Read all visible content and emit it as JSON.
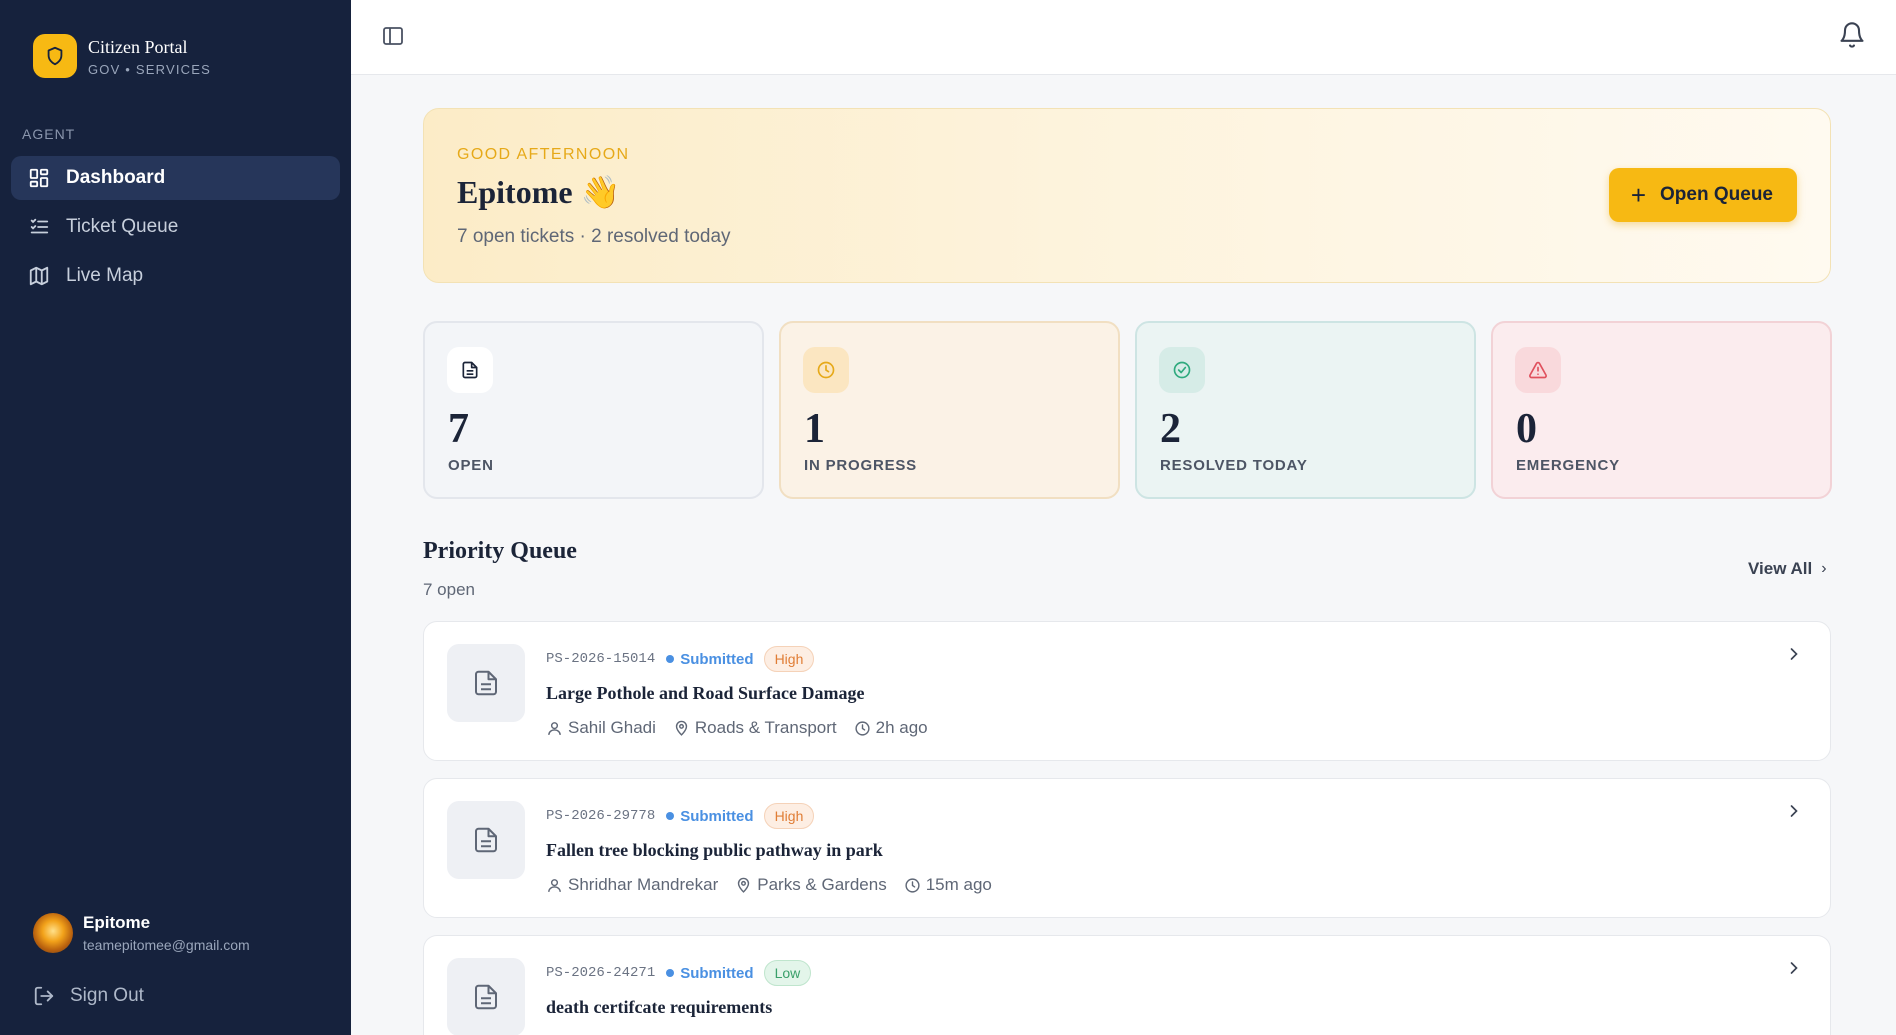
{
  "brand": {
    "title": "Citizen Portal",
    "subtitle": "GOV • SERVICES",
    "logo_icon": "shield-icon",
    "accent": "#f7b913"
  },
  "sidebar": {
    "section_label": "AGENT",
    "items": [
      {
        "label": "Dashboard",
        "icon": "dashboard-grid-icon",
        "active": true
      },
      {
        "label": "Ticket Queue",
        "icon": "list-icon",
        "active": false
      },
      {
        "label": "Live Map",
        "icon": "map-icon",
        "active": false
      }
    ],
    "user": {
      "name": "Epitome",
      "email": "teamepitomee@gmail.com"
    },
    "signout_label": "Sign Out"
  },
  "topbar": {
    "toggle_icon": "sidebar-toggle-icon",
    "bell_icon": "bell-icon"
  },
  "greeting": {
    "eyebrow": "GOOD AFTERNOON",
    "name": "Epitome 👋",
    "summary": "7 open tickets · 2 resolved today",
    "button_label": "Open Queue"
  },
  "stats": [
    {
      "value": "7",
      "label": "OPEN",
      "icon": "document-icon",
      "color": "#1b2438"
    },
    {
      "value": "1",
      "label": "IN PROGRESS",
      "icon": "clock-icon",
      "color": "#e6a919"
    },
    {
      "value": "2",
      "label": "RESOLVED TODAY",
      "icon": "check-circle-icon",
      "color": "#2faa7e"
    },
    {
      "value": "0",
      "label": "EMERGENCY",
      "icon": "warning-icon",
      "color": "#e0505d"
    }
  ],
  "priority_queue": {
    "title": "Priority Queue",
    "subtitle": "7 open",
    "view_all_label": "View All",
    "tickets": [
      {
        "id": "PS-2026-15014",
        "status": "Submitted",
        "priority": "High",
        "title": "Large Pothole and Road Surface Damage",
        "reporter": "Sahil Ghadi",
        "category": "Roads & Transport",
        "time": "2h ago"
      },
      {
        "id": "PS-2026-29778",
        "status": "Submitted",
        "priority": "High",
        "title": "Fallen tree blocking public pathway in park",
        "reporter": "Shridhar Mandrekar",
        "category": "Parks & Gardens",
        "time": "15m ago"
      },
      {
        "id": "PS-2026-24271",
        "status": "Submitted",
        "priority": "Low",
        "title": "death certifcate requirements",
        "reporter": "",
        "category": "",
        "time": ""
      }
    ]
  }
}
